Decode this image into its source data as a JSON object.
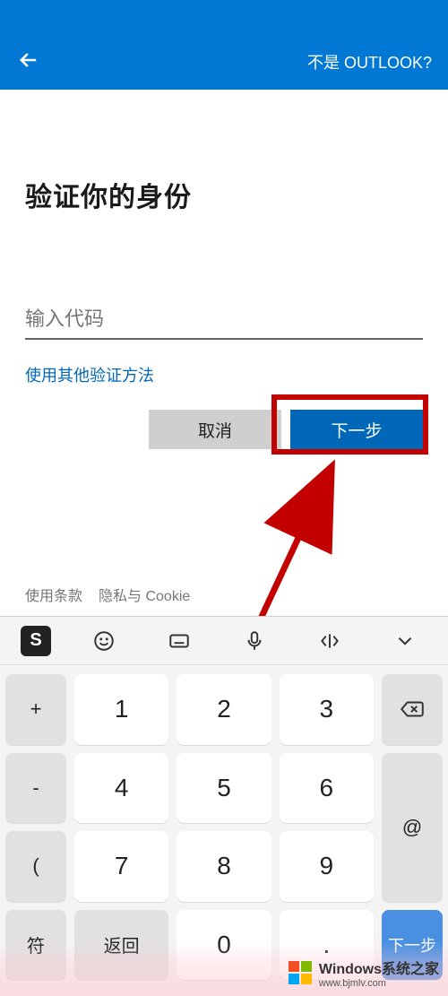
{
  "header": {
    "not_outlook_label": "不是 OUTLOOK?"
  },
  "main": {
    "title": "验证你的身份",
    "code_placeholder": "输入代码",
    "alt_method_label": "使用其他验证方法",
    "cancel_label": "取消",
    "next_label": "下一步"
  },
  "footer": {
    "terms_label": "使用条款",
    "privacy_label": "隐私与 Cookie"
  },
  "keyboard": {
    "toolbar": {
      "ime_brand": "S"
    },
    "side_left": [
      "+",
      "-",
      "("
    ],
    "side_right_backspace": "⌫",
    "side_right_at": "@",
    "digits": [
      {
        "n": "1",
        "sub": ""
      },
      {
        "n": "2",
        "sub": ""
      },
      {
        "n": "3",
        "sub": ""
      },
      {
        "n": "4",
        "sub": ""
      },
      {
        "n": "5",
        "sub": ""
      },
      {
        "n": "6",
        "sub": ""
      },
      {
        "n": "7",
        "sub": ""
      },
      {
        "n": "8",
        "sub": ""
      },
      {
        "n": "9",
        "sub": ""
      }
    ],
    "bottom": {
      "symbols_label": "符",
      "return_label": "返回",
      "zero": "0",
      "dot": ".",
      "next_label": "下一步"
    }
  },
  "watermark": {
    "text": "Windows系统之家",
    "url": "www.bjmlv.com"
  }
}
